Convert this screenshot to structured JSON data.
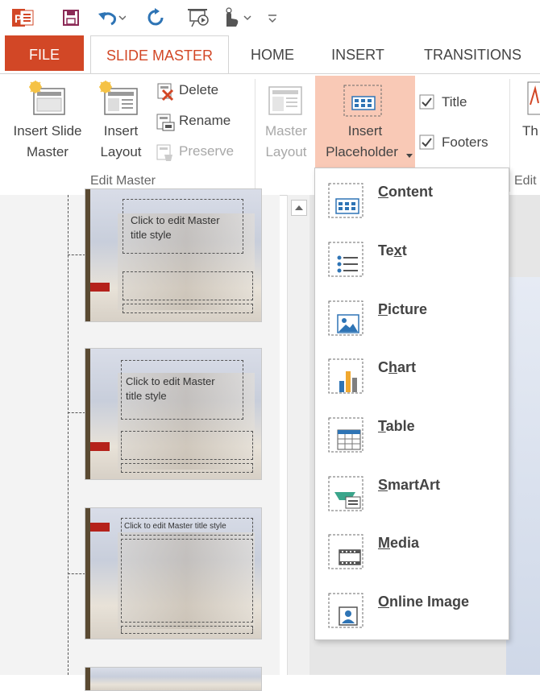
{
  "quick_access": {
    "icons": [
      "powerpoint-logo",
      "save-icon",
      "undo-icon",
      "redo-icon",
      "slideshow-icon",
      "touch-mode-icon",
      "customize-icon"
    ]
  },
  "tabs": [
    {
      "label": "FILE"
    },
    {
      "label": "SLIDE MASTER"
    },
    {
      "label": "HOME"
    },
    {
      "label": "INSERT"
    },
    {
      "label": "TRANSITIONS"
    }
  ],
  "ribbon": {
    "insert_slide_master": [
      "Insert Slide",
      "Master"
    ],
    "insert_layout": [
      "Insert",
      "Layout"
    ],
    "delete": "Delete",
    "rename": "Rename",
    "preserve": "Preserve",
    "group_edit_master": "Edit Master",
    "master_layout": [
      "Master",
      "Layout"
    ],
    "insert_placeholder": [
      "Insert",
      "Placeholder"
    ],
    "title_checkbox": "Title",
    "footers_checkbox": "Footers",
    "title_checked": true,
    "footers_checked": true,
    "themes_partial": "Th",
    "edit_partial": "Edit"
  },
  "thumbnails": [
    {
      "title_line1": "Click to edit Master",
      "title_line2": "title style"
    },
    {
      "title_line1": "Click to edit Master",
      "title_line2": "title style"
    },
    {
      "title_line1": "Click to edit Master title style",
      "title_line2": ""
    }
  ],
  "placeholder_menu": {
    "items": [
      {
        "label": "Content",
        "accel": "C",
        "icon": "content-icon"
      },
      {
        "label": "Text",
        "accel": "x",
        "icon": "text-icon"
      },
      {
        "label": "Picture",
        "accel": "P",
        "icon": "picture-icon"
      },
      {
        "label": "Chart",
        "accel": "h",
        "icon": "chart-icon"
      },
      {
        "label": "Table",
        "accel": "T",
        "icon": "table-icon"
      },
      {
        "label": "SmartArt",
        "accel": "S",
        "icon": "smartart-icon"
      },
      {
        "label": "Media",
        "accel": "M",
        "icon": "media-icon"
      },
      {
        "label": "Online Image",
        "accel": "O",
        "icon": "online-image-icon"
      }
    ]
  },
  "colors": {
    "accent": "#d24726",
    "hover": "#f9c9b6",
    "icon_blue": "#2e74b5"
  }
}
